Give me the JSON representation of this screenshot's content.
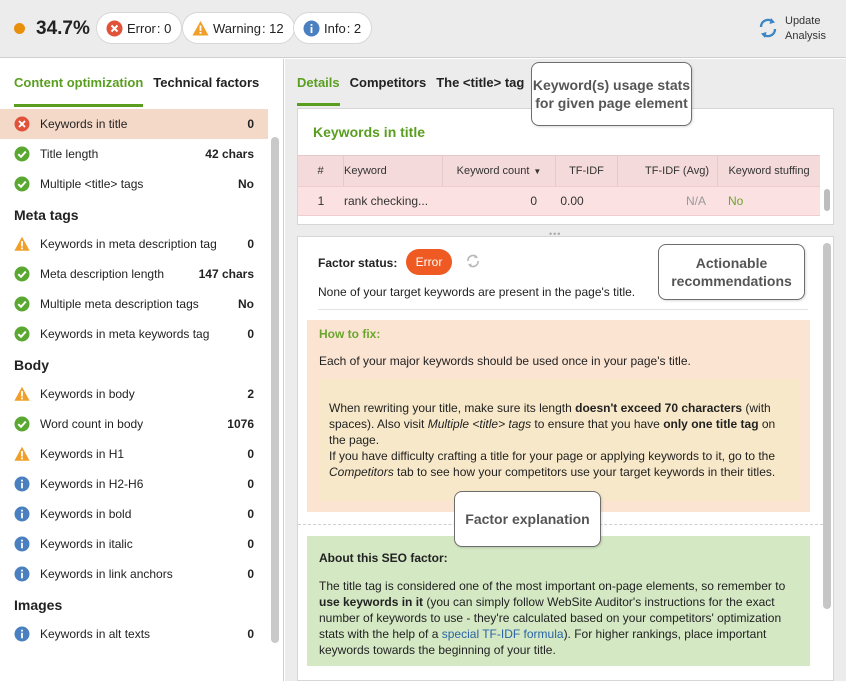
{
  "header": {
    "score": "34.7%",
    "error_label": "Error",
    "error_count": ": 0",
    "warning_label": "Warning",
    "warning_count": ": 12",
    "info_label": "Info",
    "info_count": ": 2",
    "update_line1": "Update",
    "update_line2": "Analysis",
    "score_color": "#e8900c"
  },
  "left_tabs": [
    "Content optimization",
    "Technical factors"
  ],
  "factors": [
    {
      "label": "Keywords in title",
      "value": "0",
      "status": "error"
    },
    {
      "label": "Title length",
      "value": "42 chars",
      "status": "ok"
    },
    {
      "label": "Multiple <title> tags",
      "value": "No",
      "status": "ok"
    }
  ],
  "groups": {
    "meta": "Meta tags",
    "body": "Body",
    "images": "Images"
  },
  "meta_factors": [
    {
      "label": "Keywords in meta description tag",
      "value": "0",
      "status": "warning"
    },
    {
      "label": "Meta description length",
      "value": "147 chars",
      "status": "ok"
    },
    {
      "label": "Multiple meta description tags",
      "value": "No",
      "status": "ok"
    },
    {
      "label": "Keywords in meta keywords tag",
      "value": "0",
      "status": "ok"
    }
  ],
  "body_factors": [
    {
      "label": "Keywords in body",
      "value": "2",
      "status": "warning"
    },
    {
      "label": "Word count in body",
      "value": "1076",
      "status": "ok"
    },
    {
      "label": "Keywords in H1",
      "value": "0",
      "status": "warning"
    },
    {
      "label": "Keywords in H2-H6",
      "value": "0",
      "status": "info"
    },
    {
      "label": "Keywords in bold",
      "value": "0",
      "status": "info"
    },
    {
      "label": "Keywords in italic",
      "value": "0",
      "status": "info"
    },
    {
      "label": "Keywords in link anchors",
      "value": "0",
      "status": "info"
    }
  ],
  "image_factors": [
    {
      "label": "Keywords in alt texts",
      "value": "0",
      "status": "info"
    }
  ],
  "right_tabs": [
    "Details",
    "Competitors",
    "The <title> tag"
  ],
  "keywords_box": {
    "title": "Keywords in title",
    "columns": [
      "#",
      "Keyword",
      "Keyword count",
      "TF-IDF",
      "TF-IDF (Avg)",
      "Keyword stuffing"
    ],
    "row": [
      "1",
      "rank checking...",
      "0",
      "0.00",
      "N/A",
      "No"
    ]
  },
  "factor_status": {
    "label": "Factor status:",
    "badge": "Error",
    "text": "None of your target keywords are present in the page's title."
  },
  "how_to_fix": {
    "title": "How to fix:",
    "text": "Each of your major keywords should be used once in your page's title.",
    "p1_a": "When rewriting your title, make sure its length ",
    "p1_b": "doesn't exceed 70 characters",
    "p1_c": " (with spaces). Also visit ",
    "p1_d": "Multiple <title> tags",
    "p1_e": " to ensure that you have ",
    "p1_f": "only one title tag",
    "p1_g": " on the page.",
    "p2_a": "If you have difficulty crafting a title for your page or applying keywords to it, go to the ",
    "p2_b": "Competitors",
    "p2_c": " tab to see how your competitors use your target keywords in their titles."
  },
  "about": {
    "title": "About this SEO factor:",
    "t1": "The title tag is considered one of the most important on-page elements, so remember to ",
    "t2": "use keywords in it",
    "t3": " (you can simply follow WebSite Auditor's instructions for the exact number of keywords to use - they're calculated based on your competitors' optimization stats with the help of a ",
    "link": "special TF-IDF formula",
    "t4": "). For higher rankings, place important keywords towards the beginning of your title."
  },
  "callouts": {
    "c1": "Keyword(s) usage stats for given page element",
    "c2": "Actionable recommendations",
    "c3": "Factor explanation"
  }
}
